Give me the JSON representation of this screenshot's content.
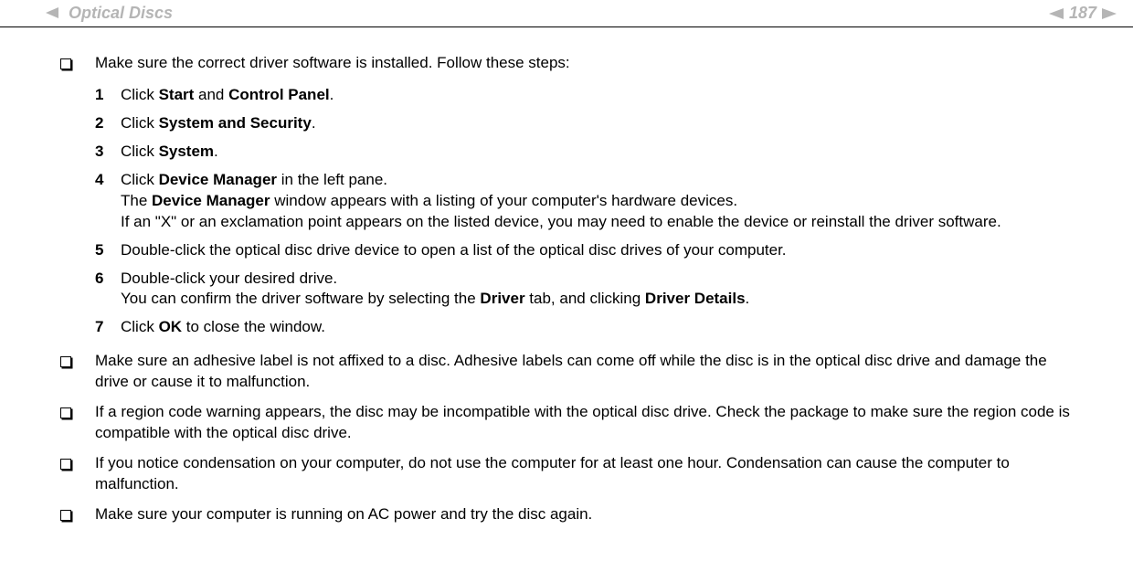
{
  "header": {
    "breadcrumb": "Optical Discs",
    "page_number": "187"
  },
  "bullets": [
    "Make sure the correct driver software is installed. Follow these steps:",
    "Make sure an adhesive label is not affixed to a disc. Adhesive labels can come off while the disc is in the optical disc drive and damage the drive or cause it to malfunction.",
    "If a region code warning appears, the disc may be incompatible with the optical disc drive. Check the package to make sure the region code is compatible with the optical disc drive.",
    "If you notice condensation on your computer, do not use the computer for at least one hour. Condensation can cause the computer to malfunction.",
    "Make sure your computer is running on AC power and try the disc again."
  ],
  "steps": {
    "s1": {
      "num": "1",
      "prefix": "Click ",
      "b1": "Start",
      "mid": " and ",
      "b2": "Control Panel",
      "suffix": "."
    },
    "s2": {
      "num": "2",
      "prefix": "Click ",
      "b1": "System and Security",
      "suffix": "."
    },
    "s3": {
      "num": "3",
      "prefix": "Click ",
      "b1": "System",
      "suffix": "."
    },
    "s4": {
      "num": "4",
      "prefix": "Click ",
      "b1": "Device Manager",
      "after_b1": " in the left pane.",
      "line2_prefix": "The ",
      "line2_b1": "Device Manager",
      "line2_suffix": " window appears with a listing of your computer's hardware devices.",
      "line3": "If an \"X\" or an exclamation point appears on the listed device, you may need to enable the device or reinstall the driver software."
    },
    "s5": {
      "num": "5",
      "text": "Double-click the optical disc drive device to open a list of the optical disc drives of your computer."
    },
    "s6": {
      "num": "6",
      "line1": "Double-click your desired drive.",
      "line2_prefix": "You can confirm the driver software by selecting the ",
      "line2_b1": "Driver",
      "line2_mid": " tab, and clicking ",
      "line2_b2": "Driver Details",
      "line2_suffix": "."
    },
    "s7": {
      "num": "7",
      "prefix": "Click ",
      "b1": "OK",
      "suffix": " to close the window."
    }
  }
}
